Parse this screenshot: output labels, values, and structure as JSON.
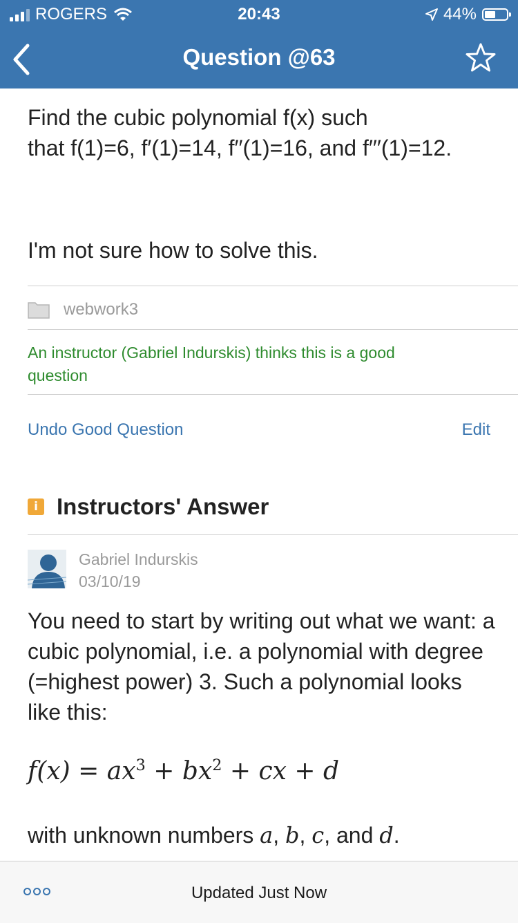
{
  "status_bar": {
    "carrier": "ROGERS",
    "time": "20:43",
    "battery": "44%"
  },
  "nav": {
    "title": "Question @63"
  },
  "question": {
    "line1": "Find the cubic polynomial f(x) such",
    "line2": "that f(1)=6, f′(1)=14, f′′(1)=16, and f′′′(1)=12.",
    "note": "I'm not sure how to solve this.",
    "folder": "webwork3",
    "endorsement": "An instructor (Gabriel Indurskis) thinks this is a good question",
    "undo_label": "Undo Good Question",
    "edit_label": "Edit"
  },
  "answer": {
    "badge": "i",
    "heading": "Instructors' Answer",
    "author": "Gabriel Indurskis",
    "date": "03/10/19",
    "paragraph": "You need to start by writing out what we want: a cubic polynomial, i.e. a polynomial with degree (=highest power) 3. Such a polynomial looks like this:",
    "formula": {
      "lhs": "f(x)",
      "eq": "=",
      "terms": [
        "ax",
        "3",
        "+",
        "bx",
        "2",
        "+",
        "cx",
        "+",
        "d"
      ]
    },
    "closing": {
      "prefix": "with unknown numbers ",
      "vars": [
        "a",
        "b",
        "c",
        "d"
      ],
      "sep1": ", ",
      "sep3": ", and ",
      "end": "."
    }
  },
  "bottom_bar": {
    "status": "Updated Just Now"
  },
  "colors": {
    "header": "#3b76b0",
    "link": "#3b76b0",
    "endorse_green": "#2e8b2e",
    "badge_orange": "#f0a838"
  }
}
